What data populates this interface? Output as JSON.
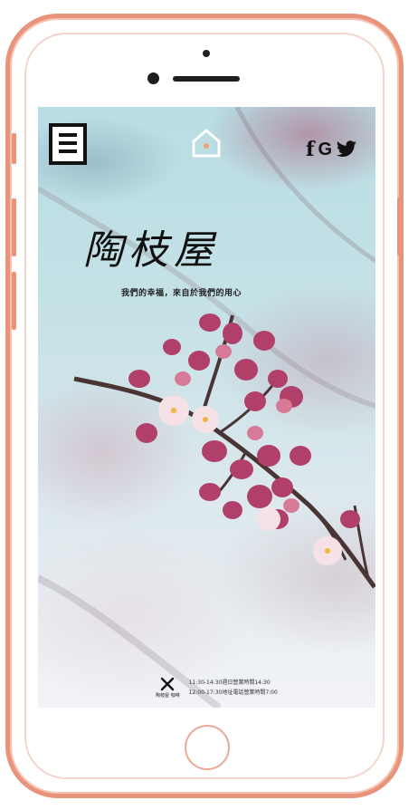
{
  "app": {
    "title": "陶枝屋",
    "slogan": "我們的幸福，來自於我們的用心"
  },
  "header": {
    "menu_icon": "hamburger-menu-icon",
    "home_icon": "home-icon",
    "social": {
      "facebook": "f",
      "google": "G",
      "twitter_icon": "twitter-icon"
    }
  },
  "footer": {
    "brand_icon": "fork-knife-icon",
    "brand_label": "陶枝屋 咖啡",
    "hours_line1": "11:30-14:30週日營業時間14:30",
    "hours_line2": "12:00-17:30地址電話營業時間7:00"
  },
  "colors": {
    "phone_frame": "#e9947a",
    "home_dot": "#f0a070",
    "text": "#111111"
  }
}
